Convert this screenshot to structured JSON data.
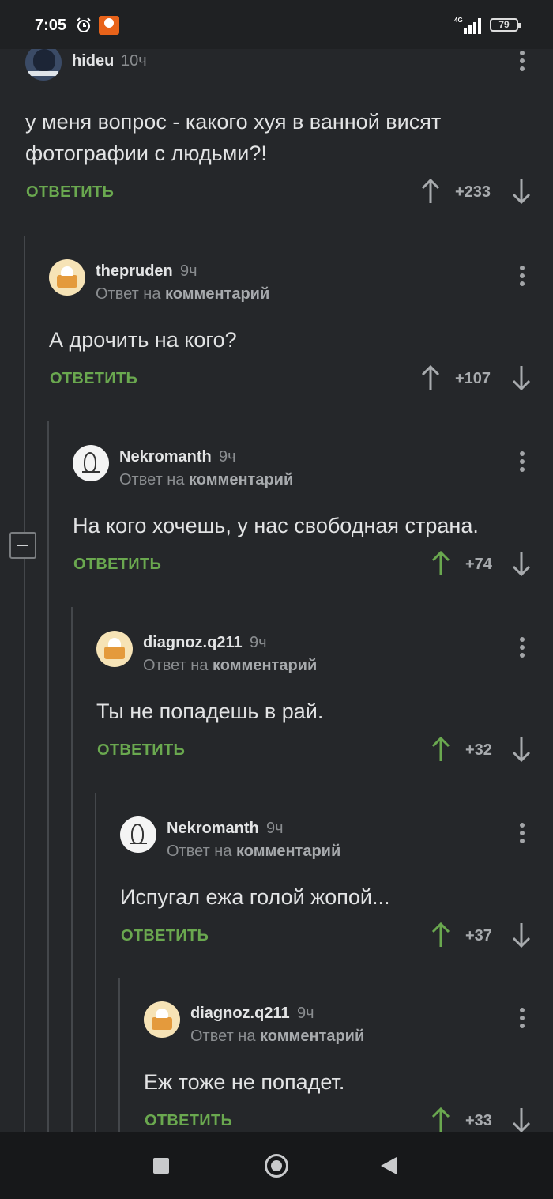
{
  "status_bar": {
    "time": "7:05",
    "network": "4G",
    "battery": "79"
  },
  "reply_label": "ОТВЕТИТЬ",
  "reply_prefix": "Ответ на",
  "reply_target": "комментарий",
  "colors": {
    "background": "#25272a",
    "reply_green": "#6aa84f",
    "upvoted_green": "#6aa84f",
    "vote_neutral": "#a8abae"
  },
  "comments": [
    {
      "username": "hideu",
      "time": "10ч",
      "avatar": "avatar-photo",
      "is_reply": false,
      "text_lines": [
        "у меня вопрос - какого хуя в ванной висят",
        "фотографии с людьми?!"
      ],
      "score": "+233",
      "upvoted": false
    },
    {
      "username": "thepruden",
      "time": "9ч",
      "avatar": "avatar-pie",
      "is_reply": true,
      "text_lines": [
        "А дрочить на кого?"
      ],
      "score": "+107",
      "upvoted": false
    },
    {
      "username": "Nekromanth",
      "time": "9ч",
      "avatar": "avatar-sketch",
      "is_reply": true,
      "text_lines": [
        "На кого хочешь, у нас свободная страна."
      ],
      "score": "+74",
      "upvoted": true
    },
    {
      "username": "diagnoz.q211",
      "time": "9ч",
      "avatar": "avatar-pie",
      "is_reply": true,
      "text_lines": [
        "Ты не попадешь в рай."
      ],
      "score": "+32",
      "upvoted": true
    },
    {
      "username": "Nekromanth",
      "time": "9ч",
      "avatar": "avatar-sketch",
      "is_reply": true,
      "text_lines": [
        "Испугал ежа голой жопой..."
      ],
      "score": "+37",
      "upvoted": true
    },
    {
      "username": "diagnoz.q211",
      "time": "9ч",
      "avatar": "avatar-pie",
      "is_reply": true,
      "text_lines": [
        "Еж тоже не попадет."
      ],
      "score": "+33",
      "upvoted": true
    }
  ]
}
